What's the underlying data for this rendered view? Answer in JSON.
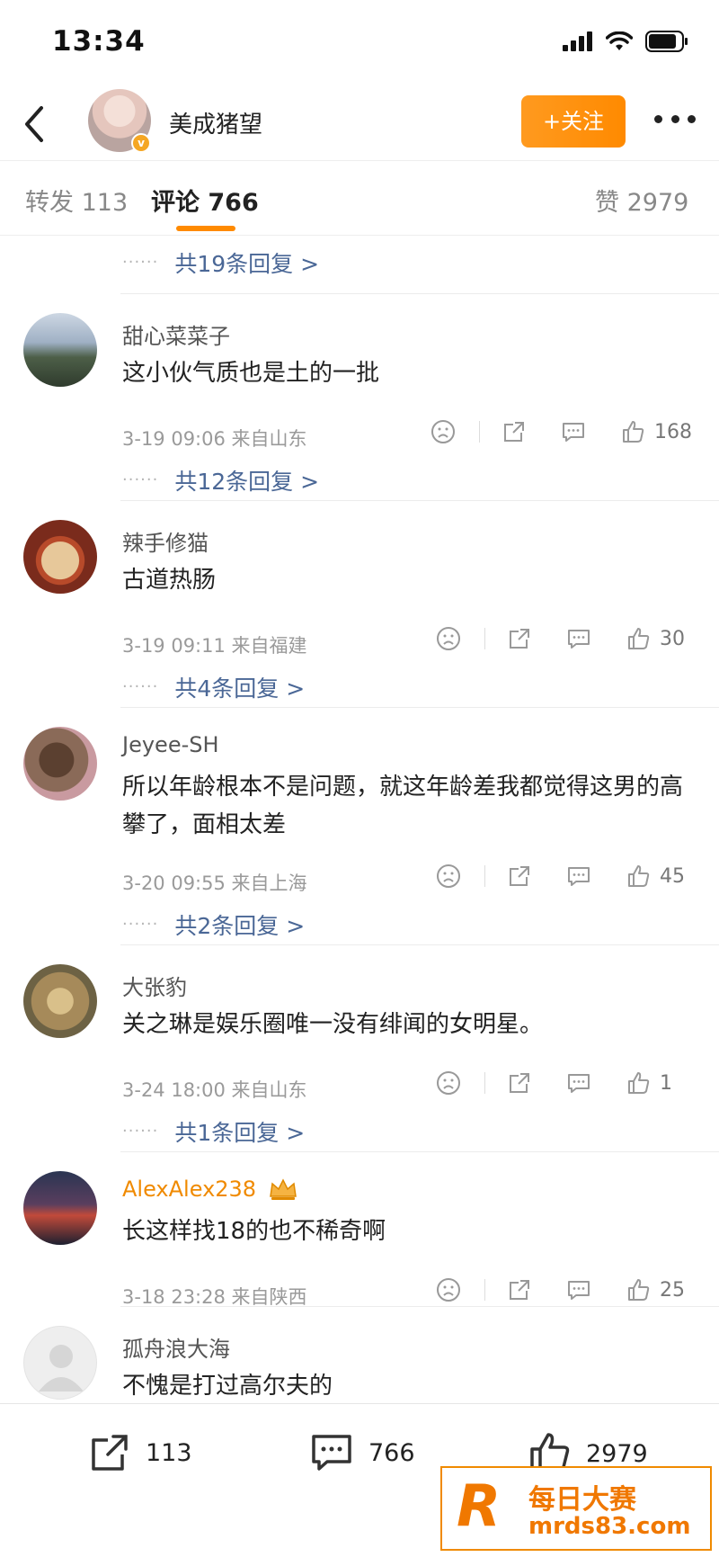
{
  "status": {
    "time": "13:34"
  },
  "header": {
    "user_name": "美成猪望",
    "follow_label": "+关注"
  },
  "tabs": [
    {
      "label": "转发 113"
    },
    {
      "label": "评论 766"
    },
    {
      "label": "赞 2979"
    }
  ],
  "top_reply_link": "共19条回复 >",
  "comments": [
    {
      "name": "甜心菜菜子",
      "text": "这小伙气质也是土的一批",
      "meta": "3-19 09:06  来自山东",
      "likes": "168",
      "replies": "共12条回复 >"
    },
    {
      "name": "辣手修猫",
      "text": "古道热肠",
      "meta": "3-19 09:11  来自福建",
      "likes": "30",
      "replies": "共4条回复 >"
    },
    {
      "name": "Jeyee-SH",
      "text": "所以年龄根本不是问题，就这年龄差我都觉得这男的高攀了，面相太差",
      "meta": "3-20 09:55  来自上海",
      "likes": "45",
      "replies": "共2条回复 >"
    },
    {
      "name": "大张豹",
      "text": "关之琳是娱乐圈唯一没有绯闻的女明星。",
      "meta": "3-24 18:00  来自山东",
      "likes": "1",
      "replies": "共1条回复 >"
    },
    {
      "name": "AlexAlex238",
      "text": "长这样找18的也不稀奇啊",
      "meta": "3-18 23:28  来自陕西",
      "likes": "25"
    },
    {
      "name": "孤舟浪大海",
      "text": "不愧是打过高尔夫的"
    }
  ],
  "bottom_bar": {
    "repost_count": "113",
    "comment_count": "766",
    "like_count": "2979"
  },
  "watermark": {
    "title": "每日大赛",
    "url": "mrds83.com",
    "logo_letter": "R"
  },
  "colors": {
    "accent": "#ff8a00",
    "link": "#4a6796",
    "vip_name": "#f08a00"
  }
}
